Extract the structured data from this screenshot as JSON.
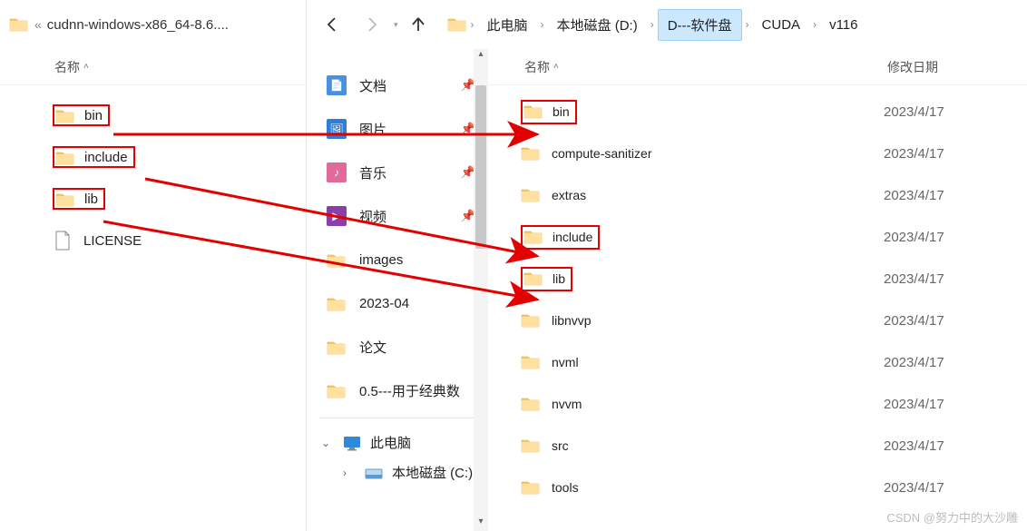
{
  "left": {
    "title_prefix": "«",
    "title": "cudnn-windows-x86_64-8.6....",
    "column_name": "名称",
    "items": [
      {
        "name": "bin",
        "type": "folder",
        "highlight": true
      },
      {
        "name": "include",
        "type": "folder",
        "highlight": true
      },
      {
        "name": "lib",
        "type": "folder",
        "highlight": true
      },
      {
        "name": "LICENSE",
        "type": "file",
        "highlight": false
      }
    ]
  },
  "nav": {
    "breadcrumb": [
      "此电脑",
      "本地磁盘 (D:)",
      "D---软件盘",
      "CUDA",
      "v116"
    ],
    "active_index": 2
  },
  "quick_access": [
    {
      "label": "文档",
      "icon": "doc",
      "color": "#4a8fe0"
    },
    {
      "label": "图片",
      "icon": "pic",
      "color": "#2e7dd8"
    },
    {
      "label": "音乐",
      "icon": "music",
      "color": "#e06a9a"
    },
    {
      "label": "视频",
      "icon": "video",
      "color": "#8a3fa8"
    },
    {
      "label": "images",
      "icon": "folder",
      "color": "#f7c95c"
    },
    {
      "label": "2023-04",
      "icon": "folder",
      "color": "#f7c95c"
    },
    {
      "label": "论文",
      "icon": "folder",
      "color": "#f7c95c"
    },
    {
      "label": "0.5---用于经典数",
      "icon": "folder",
      "color": "#f7c95c"
    }
  ],
  "tree": {
    "this_pc": "此电脑",
    "drive": "本地磁盘 (C:)"
  },
  "main": {
    "column_name": "名称",
    "column_date": "修改日期",
    "items": [
      {
        "name": "bin",
        "date": "2023/4/17",
        "highlight": true
      },
      {
        "name": "compute-sanitizer",
        "date": "2023/4/17",
        "highlight": false
      },
      {
        "name": "extras",
        "date": "2023/4/17",
        "highlight": false
      },
      {
        "name": "include",
        "date": "2023/4/17",
        "highlight": true
      },
      {
        "name": "lib",
        "date": "2023/4/17",
        "highlight": true
      },
      {
        "name": "libnvvp",
        "date": "2023/4/17",
        "highlight": false
      },
      {
        "name": "nvml",
        "date": "2023/4/17",
        "highlight": false
      },
      {
        "name": "nvvm",
        "date": "2023/4/17",
        "highlight": false
      },
      {
        "name": "src",
        "date": "2023/4/17",
        "highlight": false
      },
      {
        "name": "tools",
        "date": "2023/4/17",
        "highlight": false
      }
    ]
  },
  "watermark": "CSDN @努力中的大沙雕"
}
